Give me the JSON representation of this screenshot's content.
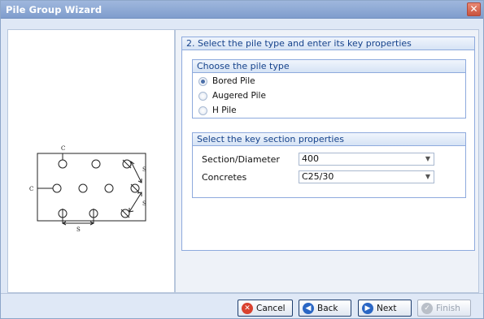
{
  "window": {
    "title": "Pile Group Wizard",
    "close_glyph": "✕"
  },
  "step": {
    "title": "2. Select the pile type and enter its key properties"
  },
  "pile_type": {
    "title": "Choose the pile type",
    "options": [
      {
        "label": "Bored Pile",
        "checked": true
      },
      {
        "label": "Augered Pile",
        "checked": false
      },
      {
        "label": "H Pile",
        "checked": false
      }
    ]
  },
  "section": {
    "title": "Select the key section properties",
    "diameter_label": "Section/Diameter",
    "diameter_value": "400",
    "concrete_label": "Concretes",
    "concrete_value": "C25/30"
  },
  "diagram": {
    "c_label": "C",
    "s_label": "S"
  },
  "buttons": {
    "cancel": "Cancel",
    "back": "Back",
    "next": "Next",
    "finish": "Finish"
  }
}
